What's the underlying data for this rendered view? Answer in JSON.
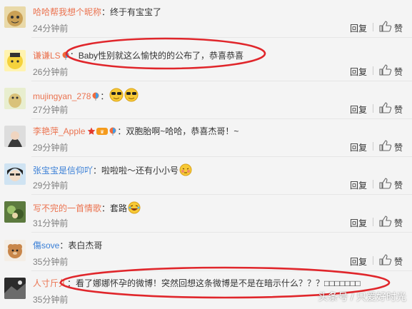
{
  "comments": [
    {
      "user": "哈哈帮我想个昵称",
      "sep": "：",
      "text": "终于有宝宝了",
      "time": "24分钟前",
      "reply": "回复",
      "like": "赞"
    },
    {
      "user": "谦谦LS",
      "sep": "：",
      "text": "Baby性别就这么愉快的的公布了，恭喜恭喜",
      "time": "26分钟前",
      "reply": "回复",
      "like": "赞"
    },
    {
      "user": "mujingyan_278",
      "sep": "：",
      "text": "",
      "time": "27分钟前",
      "reply": "回复",
      "like": "赞"
    },
    {
      "user": "李艳萍_Apple",
      "sep": "：",
      "text": "双胞胎啊~哈哈，恭喜杰哥！~",
      "time": "29分钟前",
      "reply": "回复",
      "like": "赞"
    },
    {
      "user": "张宝宝是信仰吖",
      "sep": "：",
      "text": "啦啦啦～还有小小号",
      "time": "29分钟前",
      "reply": "回复",
      "like": "赞"
    },
    {
      "user": "写不完的一首情歌",
      "sep": "：",
      "text": "套路",
      "time": "31分钟前",
      "reply": "回复",
      "like": "赞"
    },
    {
      "user": "傷sove",
      "sep": "：",
      "text": "表白杰哥",
      "time": "35分钟前",
      "reply": "回复",
      "like": "赞"
    },
    {
      "user": "人寸斤久",
      "sep": "：",
      "text": "看了娜娜怀孕的微博！突然回想这条微博是不是在暗示什么？？？□□□□□□□",
      "time": "35分钟前",
      "reply": "回复",
      "like": "赞"
    }
  ],
  "watermark": "头条号 / 只爱好时光",
  "colors": {
    "username": "#eb7350",
    "username_blue": "#3a7fd6",
    "annotation": "#e0262b"
  }
}
